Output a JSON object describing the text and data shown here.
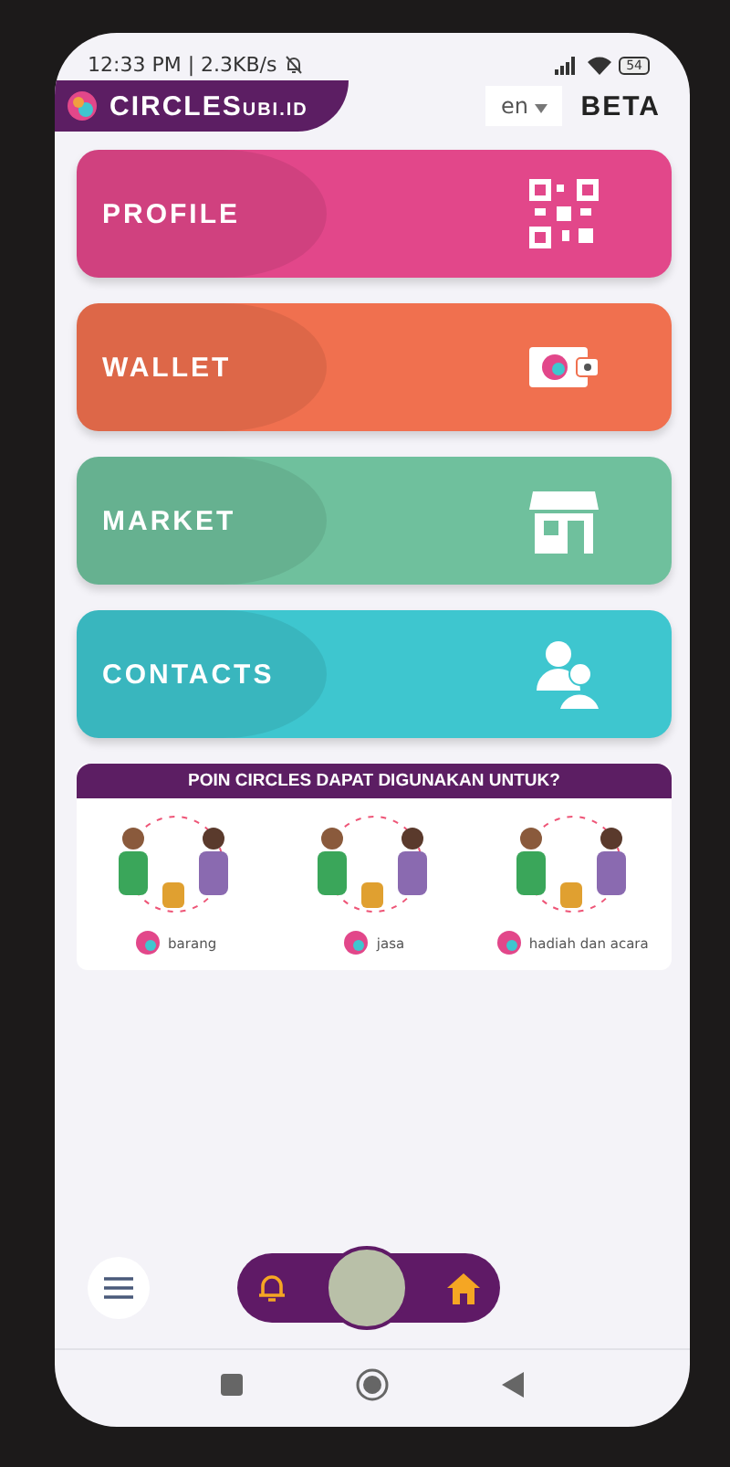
{
  "status_bar": {
    "time": "12:33 PM | 2.3KB/s",
    "battery": "54"
  },
  "header": {
    "logo_text": "CIRCLES",
    "logo_suffix": "UBI.ID",
    "language": "en",
    "badge": "BETA"
  },
  "menu": [
    {
      "label": "PROFILE",
      "kind": "profile",
      "color": "#e2478a"
    },
    {
      "label": "WALLET",
      "kind": "wallet",
      "color": "#f0704f"
    },
    {
      "label": "MARKET",
      "kind": "market",
      "color": "#6fc09d"
    },
    {
      "label": "CONTACTS",
      "kind": "contacts",
      "color": "#3ec6cf"
    }
  ],
  "promo": {
    "title": "POIN CIRCLES DAPAT DIGUNAKAN UNTUK?",
    "items": [
      {
        "caption": "barang"
      },
      {
        "caption": "jasa"
      },
      {
        "caption": "hadiah dan acara"
      }
    ]
  },
  "bottom_nav": {
    "items": [
      {
        "kind": "bell"
      },
      {
        "kind": "avatar"
      },
      {
        "kind": "home"
      }
    ]
  }
}
